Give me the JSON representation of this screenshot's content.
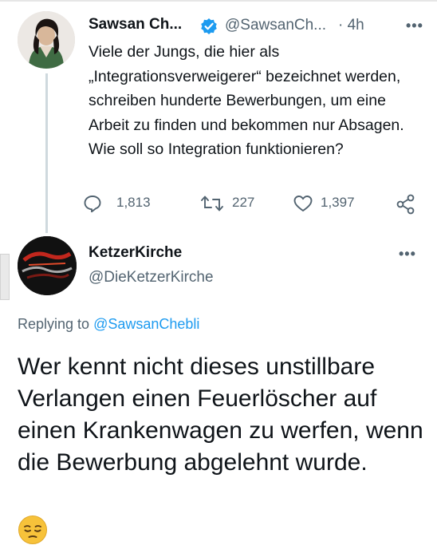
{
  "tweet": {
    "author_name": "Sawsan Ch...",
    "handle": "@SawsanCh...",
    "time": "· 4h",
    "more_icon": "more-dots-icon",
    "text": "Viele der Jungs, die hier als „Integrationsverweigerer“ bezeichnet werden, schreiben hunderte Bewerbungen, um eine Arbeit zu finden und bekommen nur Absagen. Wie soll so Integration funktionieren?",
    "replies": "1,813",
    "retweets": "227",
    "likes": "1,397"
  },
  "reply": {
    "author_name": "KetzerKirche",
    "handle": "@DieKetzerKirche",
    "replying_prefix": "Replying to ",
    "replying_to": "@SawsanChebli",
    "text": "Wer kennt nicht dieses unstillbare Verlangen einen Feuerlöscher auf einen Krankenwagen zu werfen, wenn die Bewerbung abgelehnt wurde."
  },
  "colors": {
    "text": "#0f1419",
    "secondary": "#536471",
    "link": "#1d9bf0",
    "verified": "#1d9bf0"
  }
}
